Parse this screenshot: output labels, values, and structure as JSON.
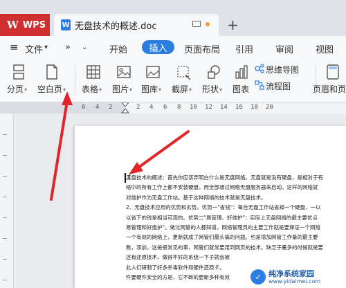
{
  "titlebar": {
    "app_tab": "WPS",
    "doc_tab_title": "无盘技术的概述.doc",
    "doc_icon": "W",
    "new_tab": "+"
  },
  "menu": {
    "hamburger": "≡",
    "file": "文件",
    "file_caret": "▾",
    "more": "»",
    "tabs": [
      "开始",
      "插入",
      "页面布局",
      "引用",
      "审阅",
      "视图"
    ],
    "active_tab": "插入"
  },
  "ribbon": {
    "page_break": "分页",
    "blank_page": "空白页",
    "table": "表格",
    "picture": "图片",
    "gallery": "图库",
    "screenshot": "截屏",
    "shape": "形状",
    "chart": "图表",
    "mindmap": "思维导图",
    "flowchart": "流程图",
    "header_footer": "页眉和页"
  },
  "ruler": {
    "numbers": [
      "6",
      "4",
      "2",
      "2",
      "4",
      "6",
      "8",
      "10",
      "12",
      "14",
      "16",
      "18",
      "20"
    ]
  },
  "document": {
    "lines": [
      "无盘技术的概述：首先你应该弄明白什么是无盘网络。无盘就是没有硬盘，是相对于有",
      "络中的所有工作上都不安装硬盘，而全部通过网络无盘服务器来启动。这样的网络就",
      "对维护作为无盘工作站。基于这种网络的技术就是无盘技术。",
      "2、无盘技术应用的优势和劣势。优势一\"省钱\"：每台无盘工作站省掉一个硬盘，一以",
      "以省下的钱是相当可观的。优势二\"易管理、好维护\"：实际上无盘网络的最主要优点",
      "易管理和好维护\"。做过网管的人都知道，网络管理员的主要工作就是要保证一个网络",
      "一个有效的网络上，更新就成了网管们最头痛的问题。也是增加网管工作量的最主要",
      "数，添加，这是很常见的事，网管们就常要用到网页的技术。缺乏于量多的时候就是要",
      "还有还原技术，做得不好的系统一下子就会被",
      "此人们研制了好多杀毒软件和硬件还原卡，",
      "件要硬件安全的方是，它不断的更新多种有效"
    ]
  },
  "watermark": {
    "title": "纯净系统家园",
    "url": "www.yidaimei.com"
  },
  "colors": {
    "wps_red": "#cf2f2f",
    "accent_blue": "#2a7de1",
    "arrow_red": "#e0252b"
  }
}
